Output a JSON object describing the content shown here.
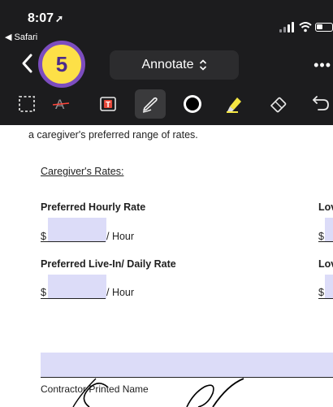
{
  "status_bar": {
    "time": "8:07",
    "location_glyph": "➚",
    "back_app": "◀ Safari",
    "icons": [
      "cellular-signal-icon",
      "wifi-icon",
      "battery-icon"
    ]
  },
  "nav": {
    "back_icon": "chevron-left-icon",
    "step_badge": "5",
    "mode_label": "Annotate",
    "mode_chevron": "⌃⌄",
    "more_label": "•••"
  },
  "toolbar": {
    "tools": [
      "select-tool-icon",
      "strikethrough-tool-icon",
      "text-box-tool-icon",
      "pen-tool-icon",
      "color-picker-icon",
      "highlighter-tool-icon",
      "eraser-tool-icon",
      "undo-icon"
    ],
    "selected_tool": "pen-tool-icon",
    "current_color": "#000000",
    "highlighter_color": "#f5e642"
  },
  "document": {
    "intro_line": "a caregiver's preferred range of rates.",
    "rates_heading": "Caregiver's Rates:",
    "hourly_label": "Preferred Hourly Rate",
    "hourly_right_label": "Lov",
    "hourly_prefix": "$",
    "hourly_suffix": "/ Hour",
    "hourly_right_prefix": "$",
    "live_in_label": "Preferred Live-In/ Daily Rate",
    "live_in_right_label": "Lov",
    "live_in_prefix": "$",
    "live_in_suffix": "/ Hour",
    "live_in_right_prefix": "$",
    "printed_name_label": "Contractor Printed Name",
    "field_color": "#dcdcf8"
  }
}
